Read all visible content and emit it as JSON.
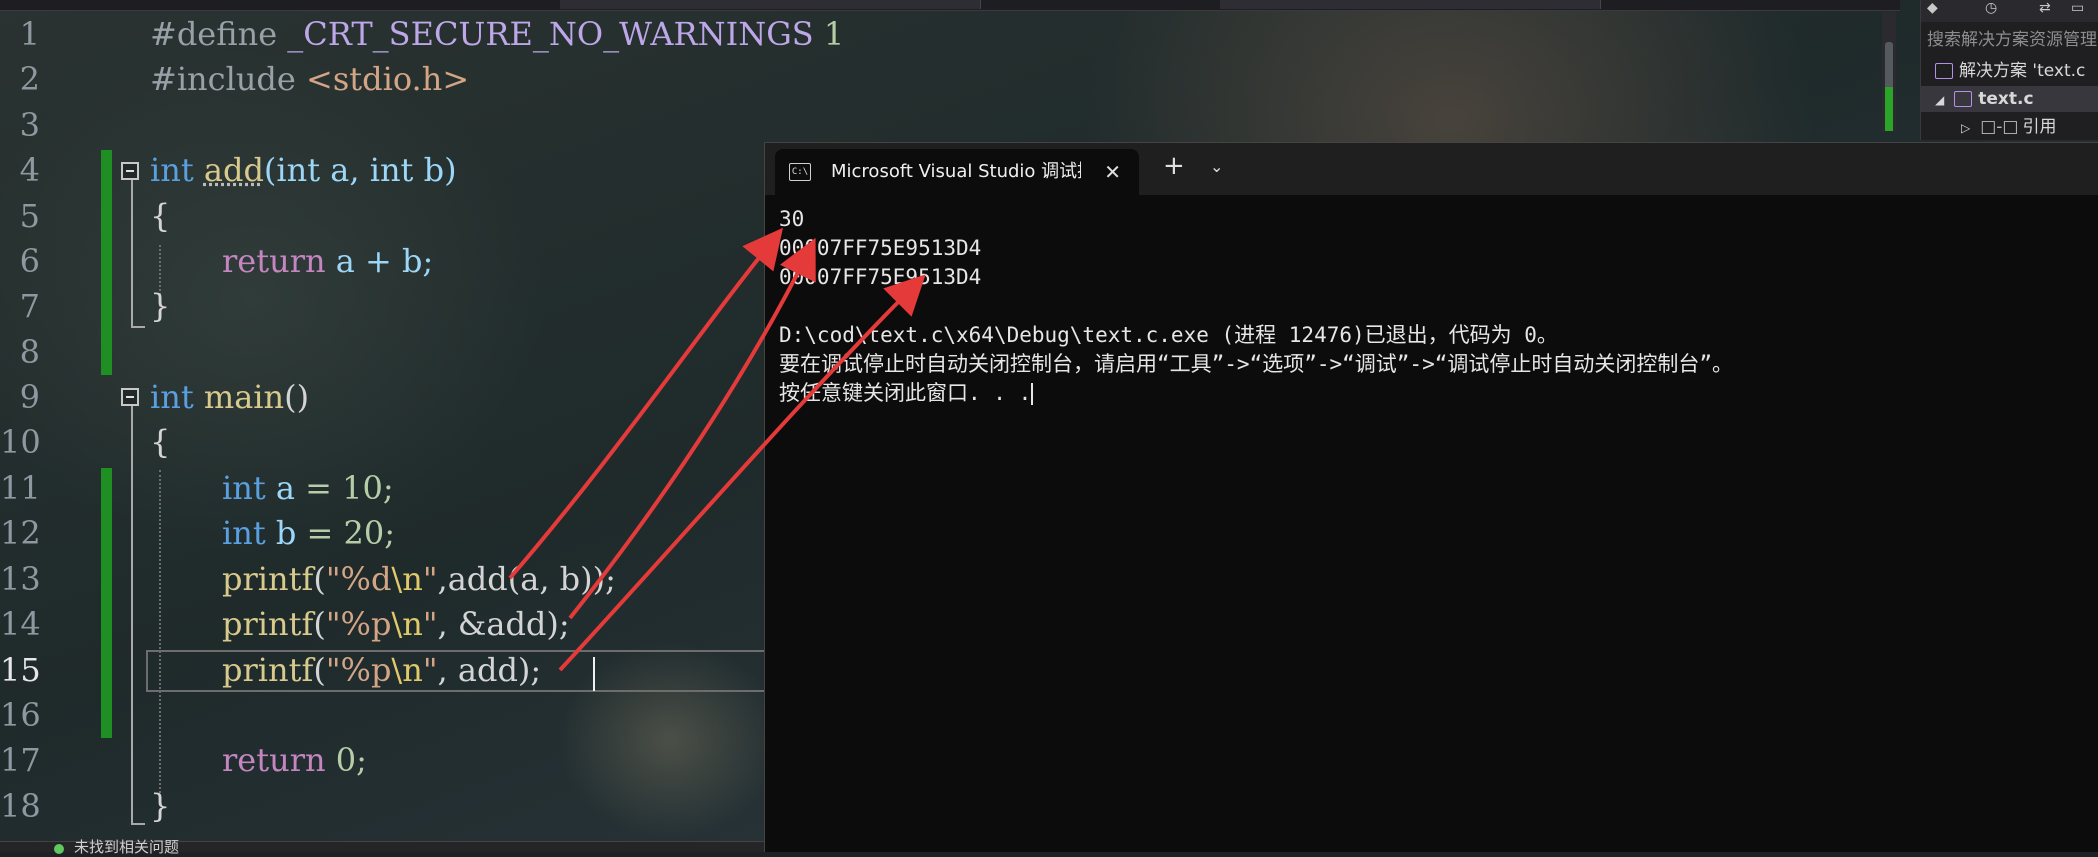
{
  "editor": {
    "line_numbers": [
      "1",
      "2",
      "3",
      "4",
      "5",
      "6",
      "7",
      "8",
      "9",
      "10",
      "11",
      "12",
      "13",
      "14",
      "15",
      "16",
      "17",
      "18"
    ],
    "current_line": "15",
    "tokens": {
      "define_kw": "#define",
      "define_name": "_CRT_SECURE_NO_WARNINGS",
      "define_val": "1",
      "include_kw": "#include",
      "include_hdr": "<stdio.h>",
      "int": "int",
      "add": "add",
      "main": "main",
      "return": "return",
      "printf": "printf",
      "a": "a",
      "b": "b",
      "lbrace": "{",
      "rbrace": "}",
      "add_params": "(int a, int b)",
      "main_params": "()",
      "ret_expr": "a + b;",
      "a_init": " = 10;",
      "b_init": " = 20;",
      "fmt_d": "\"%d",
      "fmt_p": "\"%p",
      "newline_esc": "\\n",
      "quote": "\"",
      "call13": ",add(a, b));",
      "arg14": ", &add);",
      "arg15": ", add);",
      "ret0": " 0;"
    }
  },
  "console": {
    "tab_title": "Microsoft Visual Studio 调试控制台",
    "close_glyph": "✕",
    "new_tab_glyph": "+",
    "dropdown_glyph": "⌄",
    "app_icon_text": "C:\\",
    "lines": [
      "30",
      "00007FF75E9513D4",
      "00007FF75E9513D4",
      "",
      "D:\\cod\\text.c\\x64\\Debug\\text.c.exe (进程 12476)已退出，代码为 0。",
      "要在调试停止时自动关闭控制台，请启用“工具”->“选项”->“调试”->“调试停止时自动关闭控制台”。",
      "按任意键关闭此窗口. . ."
    ]
  },
  "solution_explorer": {
    "search_placeholder": "搜索解决方案资源管理",
    "solution_label": "解决方案 'text.c",
    "project_label": "text.c",
    "references_label": "引用"
  },
  "status": {
    "text": "未找到相关问题"
  },
  "colors": {
    "keyword": "#5a9fe0",
    "function": "#d8c98c",
    "annotation_arrow": "#e53a3a",
    "change_marker": "#1f8f23"
  }
}
